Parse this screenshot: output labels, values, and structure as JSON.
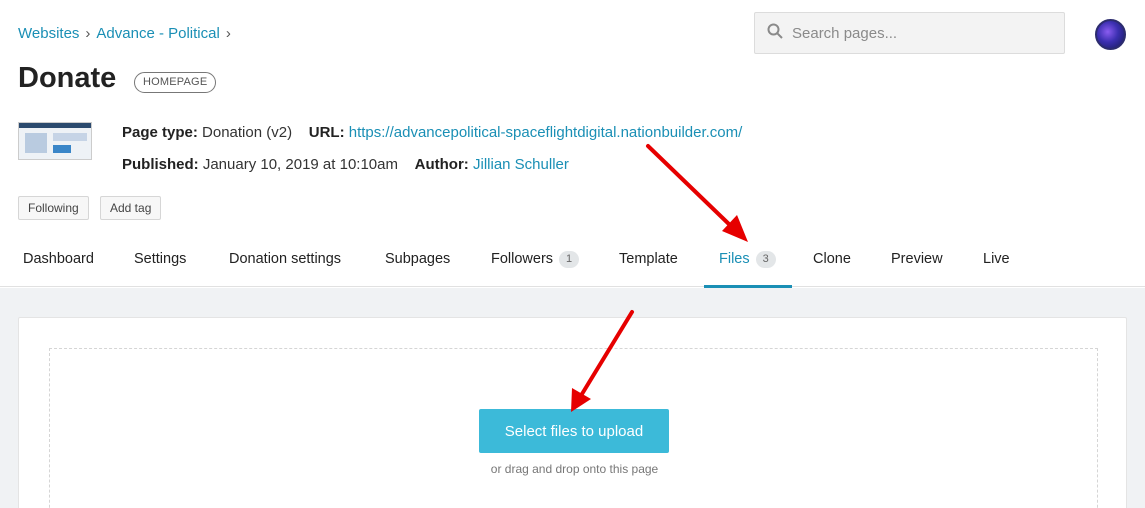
{
  "breadcrumb": {
    "items": [
      "Websites",
      "Advance - Political"
    ],
    "separator": "›"
  },
  "search": {
    "placeholder": "Search pages..."
  },
  "page": {
    "title": "Donate",
    "badge": "HOMEPAGE"
  },
  "meta": {
    "page_type_label": "Page type:",
    "page_type_value": "Donation (v2)",
    "url_label": "URL:",
    "url_value": "https://advancepolitical-spaceflightdigital.nationbuilder.com/",
    "published_label": "Published:",
    "published_value": "January 10, 2019 at 10:10am",
    "author_label": "Author:",
    "author_value": "Jillian Schuller"
  },
  "actions": {
    "following": "Following",
    "add_tag": "Add tag"
  },
  "tabs": [
    {
      "label": "Dashboard"
    },
    {
      "label": "Settings"
    },
    {
      "label": "Donation settings"
    },
    {
      "label": "Subpages"
    },
    {
      "label": "Followers",
      "count": "1"
    },
    {
      "label": "Template"
    },
    {
      "label": "Files",
      "count": "3",
      "active": true
    },
    {
      "label": "Clone"
    },
    {
      "label": "Preview"
    },
    {
      "label": "Live"
    }
  ],
  "upload": {
    "button": "Select files to upload",
    "hint": "or drag and drop onto this page"
  },
  "colors": {
    "link": "#1a8fb5",
    "button": "#3cbad9",
    "annotation": "#e60000"
  }
}
